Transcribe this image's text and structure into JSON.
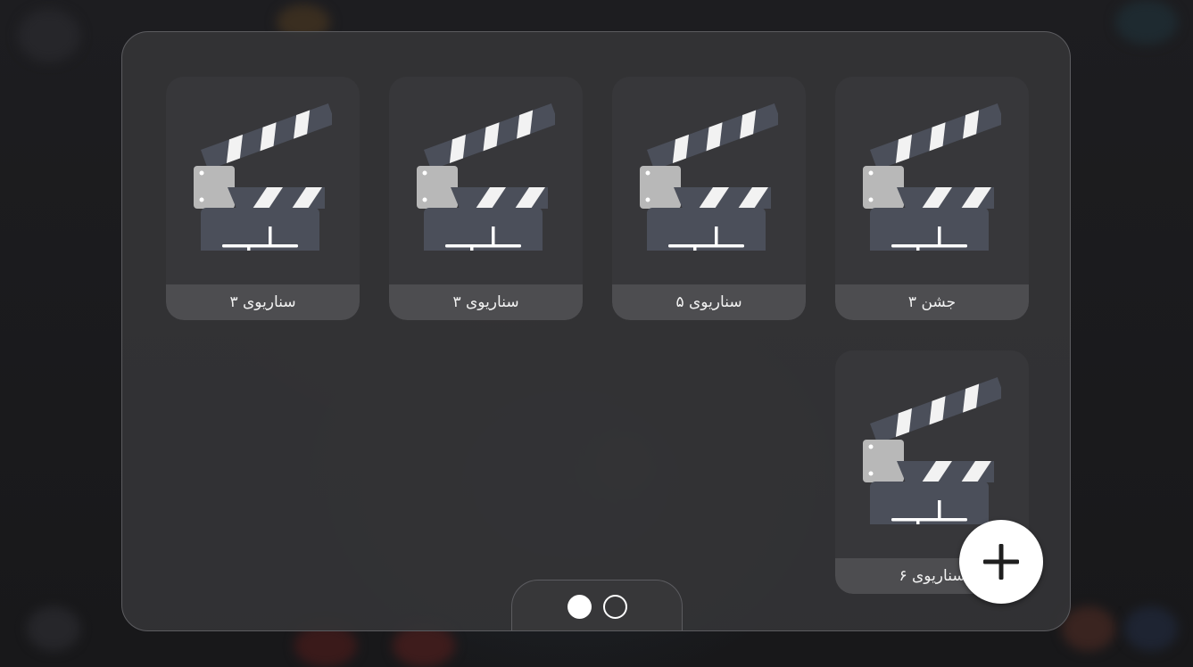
{
  "scenarios": [
    {
      "label": "جشن ۳",
      "icon": "clapperboard-icon"
    },
    {
      "label": "سناریوی ۵",
      "icon": "clapperboard-icon"
    },
    {
      "label": "سناریوی ۳",
      "icon": "clapperboard-icon"
    },
    {
      "label": "سناریوی ۳",
      "icon": "clapperboard-icon"
    },
    {
      "label": "سناریوی ۶",
      "icon": "clapperboard-icon"
    }
  ],
  "pagination": {
    "pages": 2,
    "current": 1
  },
  "add_button": {
    "icon": "plus-icon"
  },
  "colors": {
    "panel": "#343436",
    "card_label_bar": "#4d4d50",
    "clapper_body": "#4b4f5a",
    "clapper_hinge": "#b8b8b8",
    "stripe": "#f2f2f2"
  }
}
